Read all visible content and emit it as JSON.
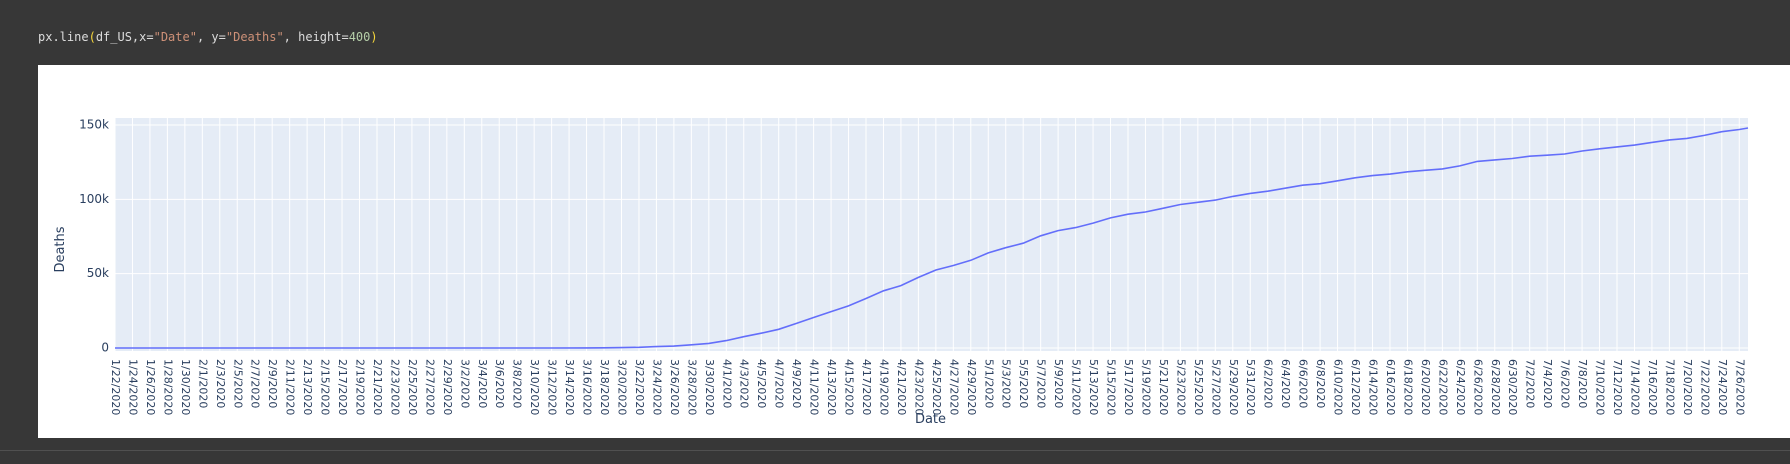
{
  "code": {
    "fn": "px.line",
    "open": "(",
    "arg1": "df_US,x=",
    "xval": "\"Date\"",
    "sep1": ", y=",
    "yval": "\"Deaths\"",
    "sep2": ", height=",
    "hval": "400",
    "close": ")"
  },
  "colors": {
    "line": "#636efa",
    "plot_bg": "#e5ecf6",
    "grid": "#ffffff",
    "tick_text": "#2a3f5f"
  },
  "chart_data": {
    "type": "line",
    "x_start": "1/22/2020",
    "x_end": "7/27/2020",
    "xlabel": "Date",
    "ylabel": "Deaths",
    "ylim": [
      -2000,
      150000
    ],
    "yticks": [
      0,
      50000,
      100000,
      150000
    ],
    "ytick_labels": [
      "0",
      "50k",
      "100k",
      "150k"
    ],
    "xtick_labels": [
      "1/22/2020",
      "1/24/2020",
      "1/26/2020",
      "1/28/2020",
      "1/30/2020",
      "2/1/2020",
      "2/3/2020",
      "2/5/2020",
      "2/7/2020",
      "2/9/2020",
      "2/11/2020",
      "2/13/2020",
      "2/15/2020",
      "2/17/2020",
      "2/19/2020",
      "2/21/2020",
      "2/23/2020",
      "2/25/2020",
      "2/27/2020",
      "2/29/2020",
      "3/2/2020",
      "3/4/2020",
      "3/6/2020",
      "3/8/2020",
      "3/10/2020",
      "3/12/2020",
      "3/14/2020",
      "3/16/2020",
      "3/18/2020",
      "3/20/2020",
      "3/22/2020",
      "3/24/2020",
      "3/26/2020",
      "3/28/2020",
      "3/30/2020",
      "4/1/2020",
      "4/3/2020",
      "4/5/2020",
      "4/7/2020",
      "4/9/2020",
      "4/11/2020",
      "4/13/2020",
      "4/15/2020",
      "4/17/2020",
      "4/19/2020",
      "4/21/2020",
      "4/23/2020",
      "4/25/2020",
      "4/27/2020",
      "4/29/2020",
      "5/1/2020",
      "5/3/2020",
      "5/5/2020",
      "5/7/2020",
      "5/9/2020",
      "5/11/2020",
      "5/13/2020",
      "5/15/2020",
      "5/17/2020",
      "5/19/2020",
      "5/21/2020",
      "5/23/2020",
      "5/25/2020",
      "5/27/2020",
      "5/29/2020",
      "5/31/2020",
      "6/2/2020",
      "6/4/2020",
      "6/6/2020",
      "6/8/2020",
      "6/10/2020",
      "6/12/2020",
      "6/14/2020",
      "6/16/2020",
      "6/18/2020",
      "6/20/2020",
      "6/22/2020",
      "6/24/2020",
      "6/26/2020",
      "6/28/2020",
      "6/30/2020",
      "7/2/2020",
      "7/4/2020",
      "7/6/2020",
      "7/8/2020",
      "7/10/2020",
      "7/12/2020",
      "7/14/2020",
      "7/16/2020",
      "7/18/2020",
      "7/20/2020",
      "7/22/2020",
      "7/24/2020",
      "7/26/2020"
    ],
    "series": [
      {
        "points": [
          [
            "1/22/2020",
            0
          ],
          [
            "2/29/2020",
            1
          ],
          [
            "3/4/2020",
            11
          ],
          [
            "3/8/2020",
            21
          ],
          [
            "3/12/2020",
            41
          ],
          [
            "3/16/2020",
            98
          ],
          [
            "3/18/2020",
            150
          ],
          [
            "3/20/2020",
            260
          ],
          [
            "3/22/2020",
            470
          ],
          [
            "3/24/2020",
            940
          ],
          [
            "3/26/2020",
            1300
          ],
          [
            "3/28/2020",
            2200
          ],
          [
            "3/30/2020",
            3100
          ],
          [
            "4/1/2020",
            5000
          ],
          [
            "4/3/2020",
            7600
          ],
          [
            "4/5/2020",
            10000
          ],
          [
            "4/7/2020",
            12600
          ],
          [
            "4/9/2020",
            16500
          ],
          [
            "4/11/2020",
            20500
          ],
          [
            "4/13/2020",
            24500
          ],
          [
            "4/15/2020",
            28300
          ],
          [
            "4/17/2020",
            33300
          ],
          [
            "4/19/2020",
            38500
          ],
          [
            "4/21/2020",
            42000
          ],
          [
            "4/23/2020",
            47500
          ],
          [
            "4/25/2020",
            52500
          ],
          [
            "4/27/2020",
            55500
          ],
          [
            "4/29/2020",
            59000
          ],
          [
            "5/1/2020",
            64000
          ],
          [
            "5/3/2020",
            67500
          ],
          [
            "5/5/2020",
            70500
          ],
          [
            "5/7/2020",
            75500
          ],
          [
            "5/9/2020",
            79000
          ],
          [
            "5/11/2020",
            81000
          ],
          [
            "5/13/2020",
            84000
          ],
          [
            "5/15/2020",
            87500
          ],
          [
            "5/17/2020",
            90000
          ],
          [
            "5/19/2020",
            91500
          ],
          [
            "5/21/2020",
            94000
          ],
          [
            "5/23/2020",
            96500
          ],
          [
            "5/25/2020",
            98000
          ],
          [
            "5/27/2020",
            99500
          ],
          [
            "5/29/2020",
            102000
          ],
          [
            "5/31/2020",
            104000
          ],
          [
            "6/2/2020",
            105500
          ],
          [
            "6/4/2020",
            107500
          ],
          [
            "6/6/2020",
            109500
          ],
          [
            "6/8/2020",
            110500
          ],
          [
            "6/10/2020",
            112500
          ],
          [
            "6/12/2020",
            114500
          ],
          [
            "6/14/2020",
            116000
          ],
          [
            "6/16/2020",
            117000
          ],
          [
            "6/18/2020",
            118500
          ],
          [
            "6/20/2020",
            119500
          ],
          [
            "6/22/2020",
            120500
          ],
          [
            "6/24/2020",
            122500
          ],
          [
            "6/26/2020",
            125500
          ],
          [
            "6/28/2020",
            126500
          ],
          [
            "6/30/2020",
            127500
          ],
          [
            "7/2/2020",
            129000
          ],
          [
            "7/4/2020",
            129700
          ],
          [
            "7/6/2020",
            130500
          ],
          [
            "7/8/2020",
            132500
          ],
          [
            "7/10/2020",
            134000
          ],
          [
            "7/12/2020",
            135300
          ],
          [
            "7/14/2020",
            136500
          ],
          [
            "7/16/2020",
            138300
          ],
          [
            "7/18/2020",
            140000
          ],
          [
            "7/20/2020",
            141000
          ],
          [
            "7/22/2020",
            143000
          ],
          [
            "7/24/2020",
            145500
          ],
          [
            "7/26/2020",
            147000
          ],
          [
            "7/27/2020",
            148000
          ]
        ]
      }
    ],
    "grid": true
  }
}
